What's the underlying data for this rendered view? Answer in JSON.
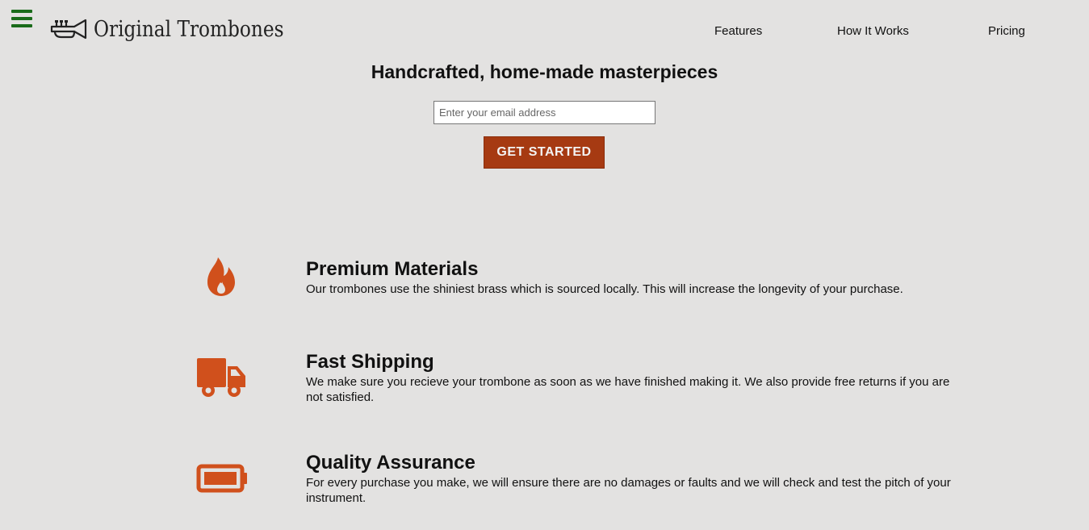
{
  "brand": {
    "name": "Original Trombones",
    "logo_icon": "trumpet-icon"
  },
  "header": {
    "menu_icon": "hamburger-menu-icon",
    "nav": {
      "features": "Features",
      "how_it_works": "How It Works",
      "pricing": "Pricing"
    }
  },
  "hero": {
    "title": "Handcrafted, home-made masterpieces",
    "email_placeholder": "Enter your email address",
    "cta_label": "GET STARTED"
  },
  "features": [
    {
      "icon": "fire-icon",
      "title": "Premium Materials",
      "description": "Our trombones use the shiniest brass which is sourced locally. This will increase the longevity of your purchase."
    },
    {
      "icon": "truck-icon",
      "title": "Fast Shipping",
      "description": "We make sure you recieve your trombone as soon as we have finished making it. We also provide free returns if you are not satisfied."
    },
    {
      "icon": "battery-icon",
      "title": "Quality Assurance",
      "description": "For every purchase you make, we will ensure there are no damages or faults and we will check and test the pitch of your instrument."
    }
  ],
  "colors": {
    "background": "#e3e2e1",
    "accent": "#d0501c",
    "button": "#a63a12",
    "menu": "#1a6b1a"
  }
}
